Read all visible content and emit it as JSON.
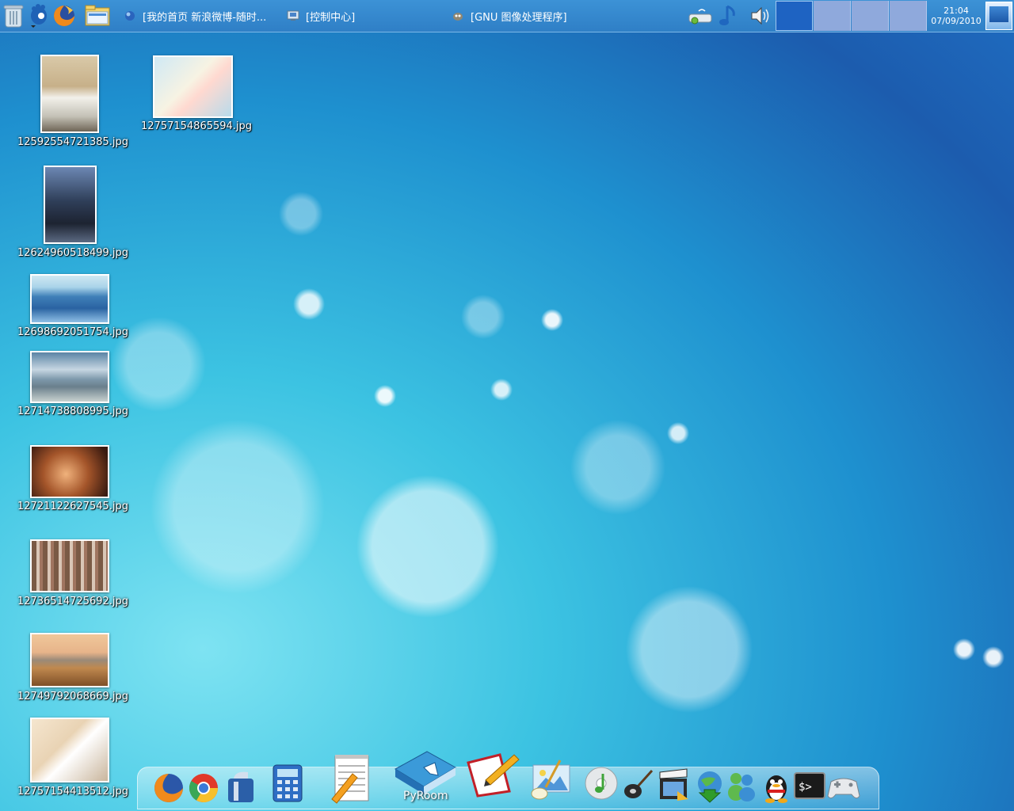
{
  "top_panel": {
    "launchers": [
      {
        "name": "trash-icon"
      },
      {
        "name": "gnome-menu-icon"
      },
      {
        "name": "firefox-icon"
      },
      {
        "name": "file-manager-icon"
      }
    ],
    "tasks": [
      {
        "label": "[我的首页 新浪微博-随时..."
      },
      {
        "label": "[控制中心]"
      },
      {
        "label": "[GNU 图像处理程序]"
      }
    ],
    "tray": [
      "network-icon",
      "music-note-icon",
      "volume-icon"
    ],
    "workspaces": {
      "count": 4,
      "active": 1
    },
    "clock": {
      "time": "21:04",
      "date": "07/09/2010"
    },
    "colors": {
      "panel": "#3c92d6",
      "workspace_active": "#1e63c2",
      "workspace_idle": "#8fa9dc"
    }
  },
  "desktop": {
    "icons": [
      {
        "name": "12592554721385.jpg"
      },
      {
        "name": "12757154865594.jpg"
      },
      {
        "name": "12624960518499.jpg"
      },
      {
        "name": "12698692051754.jpg"
      },
      {
        "name": "12714738808995.jpg"
      },
      {
        "name": "12721122627545.jpg"
      },
      {
        "name": "12736514725692.jpg"
      },
      {
        "name": "12749792068669.jpg"
      },
      {
        "name": "12757154413512.jpg"
      }
    ]
  },
  "dock": {
    "pyroom_label": "PyRoom",
    "items": [
      "firefox",
      "chrome",
      "app-launcher",
      "calculator",
      "text-editor",
      "pyroom",
      "notes",
      "image-viewer",
      "music-player",
      "guitar",
      "movie-player",
      "downloader",
      "messenger",
      "qq",
      "terminal",
      "game-controller"
    ]
  }
}
